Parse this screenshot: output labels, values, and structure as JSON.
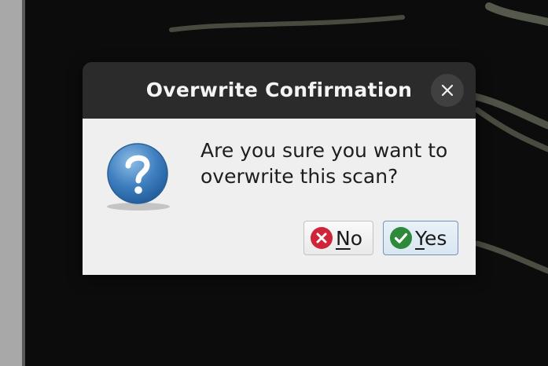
{
  "dialog": {
    "title": "Overwrite Confirmation",
    "close_icon": "close-icon",
    "message": "Are you sure you want to\noverwrite this scan?",
    "icon": "question-icon"
  },
  "buttons": {
    "no": {
      "mnemonic": "N",
      "rest": "o",
      "icon": "cancel-circle-icon",
      "icon_color": "#d0243a"
    },
    "yes": {
      "mnemonic": "Y",
      "rest": "es",
      "icon": "check-circle-icon",
      "icon_color": "#2c8a3a"
    }
  },
  "colors": {
    "titlebar": "#2b2b2b",
    "dialog_body": "#efefef",
    "default_button_border": "#6f95bd"
  }
}
